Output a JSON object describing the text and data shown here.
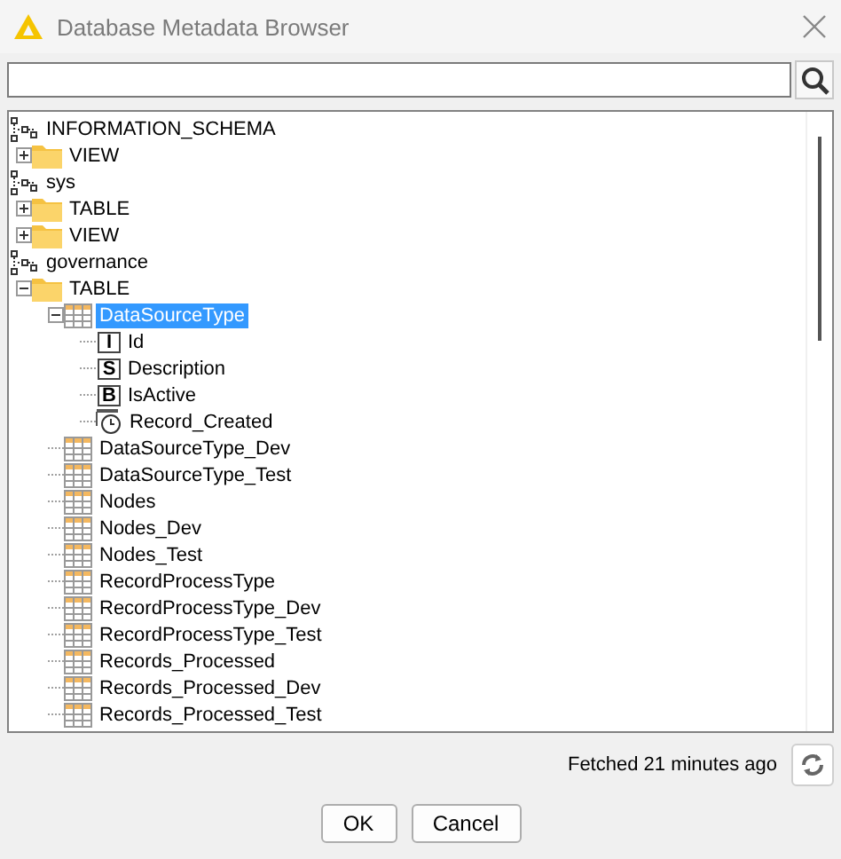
{
  "window": {
    "title": "Database Metadata Browser"
  },
  "tree": [
    {
      "kind": "schema",
      "label": "INFORMATION_SCHEMA",
      "children": [
        {
          "kind": "folder",
          "label": "VIEW",
          "expanded": false
        }
      ]
    },
    {
      "kind": "schema",
      "label": "sys",
      "children": [
        {
          "kind": "folder",
          "label": "TABLE",
          "expanded": false
        },
        {
          "kind": "folder",
          "label": "VIEW",
          "expanded": false
        }
      ]
    },
    {
      "kind": "schema",
      "label": "governance",
      "children": [
        {
          "kind": "folder",
          "label": "TABLE",
          "expanded": true,
          "children": [
            {
              "kind": "table",
              "label": "DataSourceType",
              "expanded": true,
              "selected": true,
              "children": [
                {
                  "kind": "column",
                  "type_letter": "I",
                  "label": "Id"
                },
                {
                  "kind": "column",
                  "type_letter": "S",
                  "label": "Description"
                },
                {
                  "kind": "column",
                  "type_letter": "B",
                  "label": "IsActive"
                },
                {
                  "kind": "timestamp",
                  "label": "Record_Created"
                }
              ]
            },
            {
              "kind": "table",
              "label": "DataSourceType_Dev",
              "selected": false
            },
            {
              "kind": "table",
              "label": "DataSourceType_Test",
              "selected": false
            },
            {
              "kind": "table",
              "label": "Nodes",
              "selected": false
            },
            {
              "kind": "table",
              "label": "Nodes_Dev",
              "selected": false
            },
            {
              "kind": "table",
              "label": "Nodes_Test",
              "selected": false
            },
            {
              "kind": "table",
              "label": "RecordProcessType",
              "selected": false
            },
            {
              "kind": "table",
              "label": "RecordProcessType_Dev",
              "selected": false
            },
            {
              "kind": "table",
              "label": "RecordProcessType_Test",
              "selected": false
            },
            {
              "kind": "table",
              "label": "Records_Processed",
              "selected": false
            },
            {
              "kind": "table",
              "label": "Records_Processed_Dev",
              "selected": false
            },
            {
              "kind": "table",
              "label": "Records_Processed_Test",
              "selected": false
            }
          ]
        }
      ]
    }
  ],
  "status": "Fetched 21 minutes ago",
  "buttons": [
    "OK",
    "Cancel"
  ]
}
